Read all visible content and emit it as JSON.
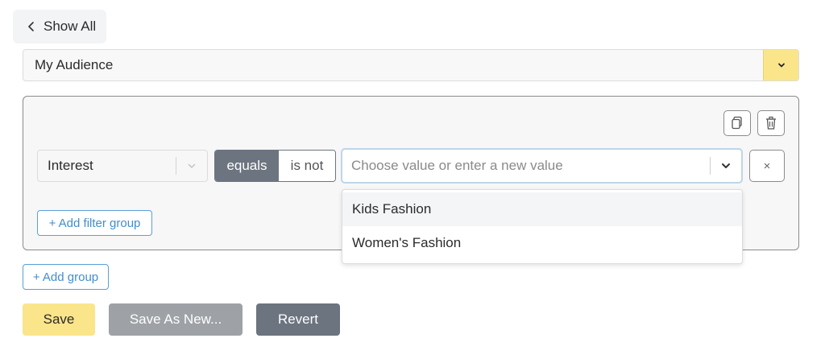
{
  "nav": {
    "show_all": "Show All"
  },
  "audience": {
    "selected": "My Audience"
  },
  "filter": {
    "field": "Interest",
    "operator_equals": "equals",
    "operator_is_not": "is not",
    "value_placeholder": "Choose value or enter a new value",
    "remove_label": "×",
    "dropdown_options": [
      "Kids Fashion",
      "Women's Fashion"
    ]
  },
  "group": {
    "add_filter_group": "+ Add filter group"
  },
  "add_group": "+ Add group",
  "actions": {
    "save": "Save",
    "save_as_new": "Save As New...",
    "revert": "Revert"
  },
  "colors": {
    "accent_yellow": "#fbe58a",
    "operator_active": "#6c7480",
    "link_blue": "#3f8ed0"
  }
}
